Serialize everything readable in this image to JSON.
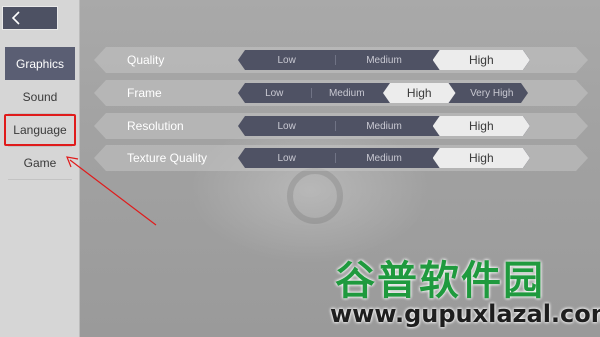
{
  "back_button": {
    "icon": "chevron-left-icon"
  },
  "sidebar": {
    "items": [
      {
        "label": "Graphics",
        "active": true
      },
      {
        "label": "Sound",
        "active": false
      },
      {
        "label": "Language",
        "active": false,
        "highlighted": true
      },
      {
        "label": "Game",
        "active": false
      }
    ]
  },
  "settings": {
    "rows": [
      {
        "label": "Quality",
        "options": [
          "Low",
          "Medium",
          "High"
        ],
        "selected": "High"
      },
      {
        "label": "Frame",
        "options": [
          "Low",
          "Medium",
          "High",
          "Very High"
        ],
        "selected": "High"
      },
      {
        "label": "Resolution",
        "options": [
          "Low",
          "Medium",
          "High"
        ],
        "selected": "High"
      },
      {
        "label": "Texture Quality",
        "options": [
          "Low",
          "Medium",
          "High"
        ],
        "selected": "High"
      }
    ]
  },
  "annotation": {
    "color": "#e01b1b"
  },
  "watermark": {
    "cn": "谷普软件园",
    "url": "www.gupuxlazal.com",
    "color": "#1f9a3e"
  },
  "colors": {
    "accent": "#5a5e73",
    "segment_bg": "#4f5264",
    "selected_bg": "#ececec"
  }
}
